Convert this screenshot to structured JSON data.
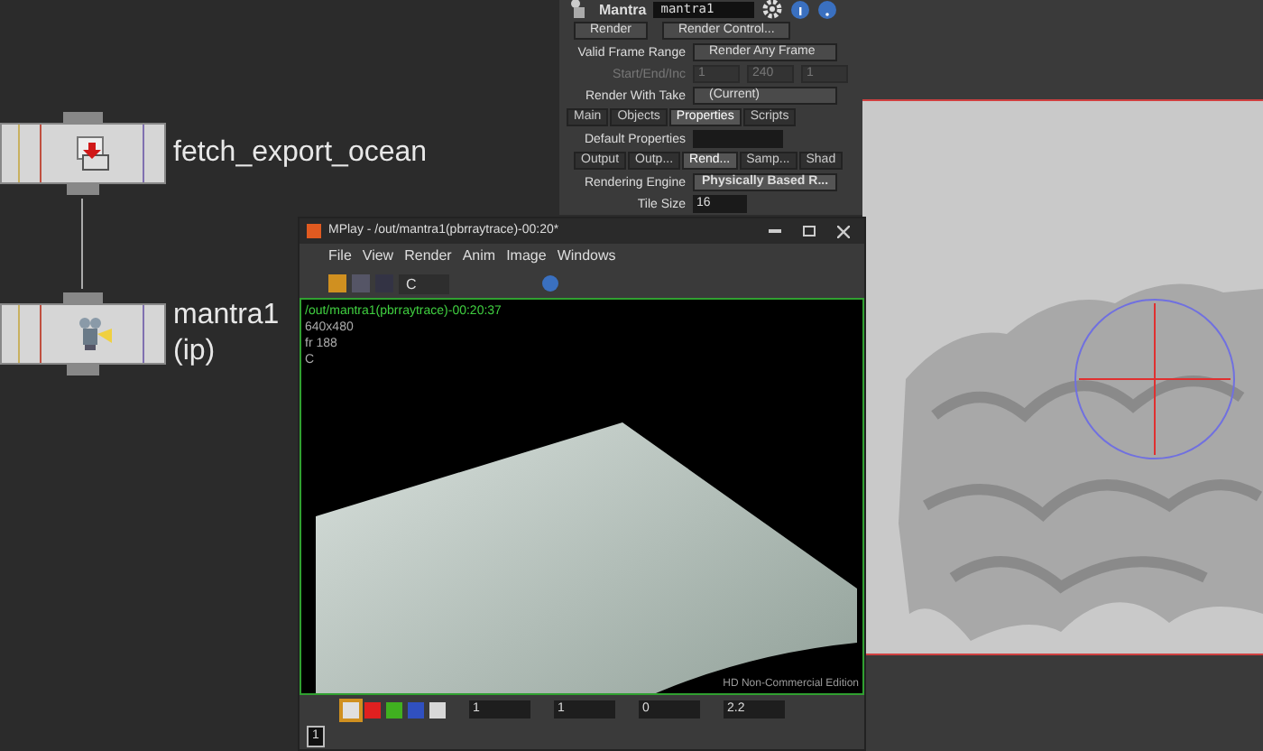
{
  "network": {
    "nodes": [
      {
        "kind": "fetch",
        "lines": [
          "fetch_export_ocean"
        ]
      },
      {
        "kind": "mantra",
        "lines": [
          "mantra1",
          "(ip)"
        ]
      }
    ]
  },
  "params": {
    "node_type": "Mantra",
    "node_name": "mantra1",
    "buttons": [
      "Render",
      "Render Control..."
    ],
    "rows": [
      {
        "kind": "menu",
        "label": "Valid Frame Range",
        "value": "Render Any Frame",
        "disabled": false
      },
      {
        "kind": "triple",
        "label": "Start/End/Inc",
        "values": [
          "1",
          "240",
          "1"
        ],
        "disabled": true
      },
      {
        "kind": "menu",
        "label": "Render With Take",
        "value": "(Current)",
        "disabled": false
      }
    ],
    "tabs": [
      {
        "label": "Main",
        "selected": false
      },
      {
        "label": "Objects",
        "selected": false
      },
      {
        "label": "Properties",
        "selected": true
      },
      {
        "label": "Scripts",
        "selected": false
      }
    ],
    "default_properties": "Default Properties",
    "subtabs": [
      {
        "label": "Output",
        "selected": false
      },
      {
        "label": "Outp...",
        "selected": false
      },
      {
        "label": "Rend...",
        "selected": true
      },
      {
        "label": "Samp...",
        "selected": false
      },
      {
        "label": "Shad",
        "selected": false
      }
    ],
    "rendering_engine": {
      "label": "Rendering Engine",
      "value": "Physically Based R..."
    },
    "tile_size": {
      "label": "Tile Size",
      "value": "16"
    }
  },
  "mplay": {
    "title": "MPlay - /out/mantra1(pbrraytrace)-00:20*",
    "menu": [
      "File",
      "View",
      "Render",
      "Anim",
      "Image",
      "Windows"
    ],
    "plane": "C",
    "info": [
      "/out/mantra1(pbrraytrace)-00:20:37",
      "640x480",
      "fr 188",
      "C"
    ],
    "edition": "HD Non-Commercial Edition",
    "channels": [
      {
        "color": "#e0e0e0",
        "selected": true
      },
      {
        "color": "#e02020",
        "selected": false
      },
      {
        "color": "#40b020",
        "selected": false
      },
      {
        "color": "#3050c0",
        "selected": false
      },
      {
        "color": "#d8d8d8",
        "selected": false
      }
    ],
    "fields": [
      "1",
      "1",
      "0",
      "2.2"
    ],
    "frame": "1"
  }
}
